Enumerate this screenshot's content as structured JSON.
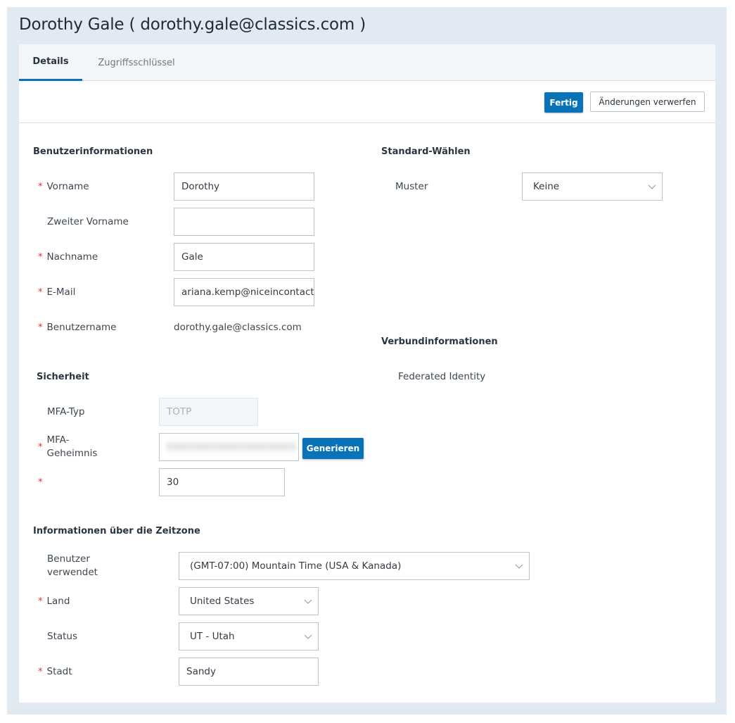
{
  "header": {
    "title": "Dorothy Gale ( dorothy.gale@classics.com )"
  },
  "tabs": [
    {
      "label": "Details",
      "active": true
    },
    {
      "label": "Zugriffsschlüssel",
      "active": false
    }
  ],
  "toolbar": {
    "done_label": "Fertig",
    "discard_label": "Änderungen verwerfen"
  },
  "colors": {
    "accent": "#0a73b7",
    "required": "#e03131",
    "frame_bg": "#e1e9f2"
  },
  "user_info": {
    "title": "Benutzerinformationen",
    "required_mark": "*",
    "fields": {
      "first_name": {
        "label": "Vorname",
        "value": "Dorothy",
        "required": true
      },
      "middle_name": {
        "label": "Zweiter Vorname",
        "value": "",
        "required": false
      },
      "last_name": {
        "label": "Nachname",
        "value": "Gale",
        "required": true
      },
      "email": {
        "label": "E-Mail",
        "value": "ariana.kemp@niceincontact",
        "required": true
      },
      "username": {
        "label": "Benutzername",
        "value": "dorothy.gale@classics.com",
        "required": true
      }
    }
  },
  "default_dial": {
    "title": "Standard-Wählen",
    "pattern": {
      "label": "Muster",
      "value": "Keine"
    }
  },
  "federation": {
    "title": "Verbundinformationen",
    "label": "Federated Identity"
  },
  "security": {
    "title": "Sicherheit",
    "mfa_type": {
      "label": "MFA-Typ",
      "value": "TOTP"
    },
    "mfa_secret": {
      "label_line1": "MFA-",
      "label_line2": "Geheimnis",
      "value": "XXXXXXXXXXXXXXXXXX",
      "generate_label": "Generieren"
    },
    "interval": {
      "label": "",
      "value": "30"
    }
  },
  "timezone": {
    "title": "Informationen über die Zeitzone",
    "user_uses": {
      "label_line1": "Benutzer",
      "label_line2": "verwendet",
      "value": "(GMT-07:00) Mountain Time (USA & Kanada)"
    },
    "country": {
      "label": "Land",
      "value": "United States"
    },
    "state": {
      "label": "Status",
      "value": "UT - Utah"
    },
    "city": {
      "label": "Stadt",
      "value": "Sandy"
    }
  }
}
